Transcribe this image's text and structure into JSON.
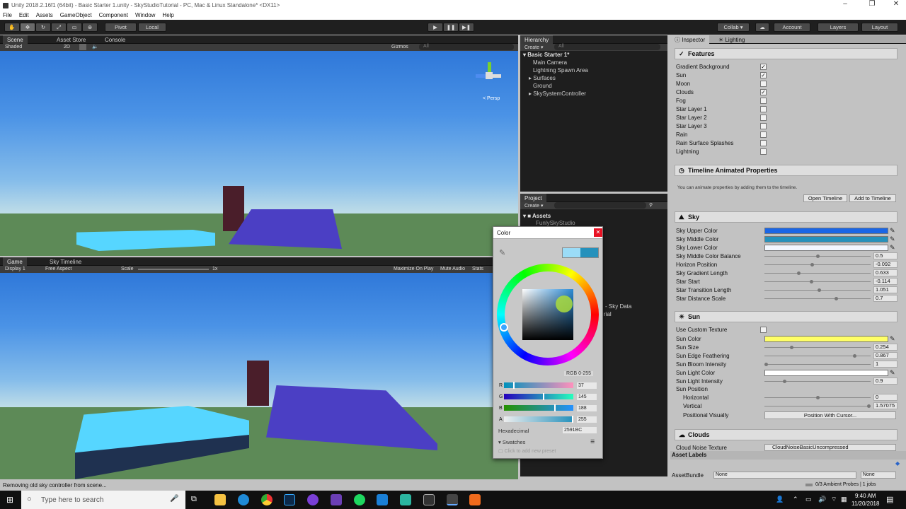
{
  "window": {
    "title": "Unity 2018.2.16f1 (64bit) - Basic Starter 1.unity - SkyStudioTutorial - PC, Mac & Linux Standalone* <DX11>"
  },
  "menu": [
    "File",
    "Edit",
    "Assets",
    "GameObject",
    "Component",
    "Window",
    "Help"
  ],
  "toolbar": {
    "pivot": "Pivot",
    "local": "Local",
    "collab": "Collab ▾",
    "account": "Account",
    "layers": "Layers",
    "layout": "Layout"
  },
  "scene": {
    "tabs": [
      "Scene",
      "Asset Store",
      "Console"
    ],
    "shaded": "Shaded",
    "mode2d": "2D",
    "gizmos": "Gizmos",
    "search": "All",
    "persp": "< Persp"
  },
  "game": {
    "tabs": [
      "Game",
      "Sky Timeline"
    ],
    "display": "Display 1",
    "aspect": "Free Aspect",
    "scale_label": "Scale",
    "scale_value": "1x",
    "maximize": "Maximize On Play",
    "mute": "Mute Audio",
    "stats": "Stats"
  },
  "hierarchy": {
    "tab": "Hierarchy",
    "create": "Create ▾",
    "search": "All",
    "scene": "Basic Starter 1*",
    "items": [
      "Main Camera",
      "Lightning Spawn Area",
      "Surfaces",
      "Ground",
      "SkySystemController"
    ]
  },
  "project": {
    "tab": "Project",
    "create": "Create ▾",
    "root": "Assets",
    "sub": "FunlySkyStudio",
    "partial1": "- Sky Data",
    "partial2": "rial"
  },
  "color_picker": {
    "title": "Color",
    "mode": "RGB 0-255",
    "channels": [
      {
        "label": "R",
        "value": "37"
      },
      {
        "label": "G",
        "value": "145"
      },
      {
        "label": "B",
        "value": "188"
      },
      {
        "label": "A",
        "value": "255"
      }
    ],
    "hex_label": "Hexadecimal",
    "hex_value": "2591BC",
    "swatches": "Swatches",
    "preset": "Click to add new preset"
  },
  "inspector": {
    "tabs": [
      "Inspector",
      "Lighting"
    ],
    "features": {
      "title": "Features",
      "items": [
        {
          "label": "Gradient Background",
          "checked": true
        },
        {
          "label": "Sun",
          "checked": true
        },
        {
          "label": "Moon",
          "checked": false
        },
        {
          "label": "Clouds",
          "checked": true
        },
        {
          "label": "Fog",
          "checked": false
        },
        {
          "label": "Star Layer 1",
          "checked": false
        },
        {
          "label": "Star Layer 2",
          "checked": false
        },
        {
          "label": "Star Layer 3",
          "checked": false
        },
        {
          "label": "Rain",
          "checked": false
        },
        {
          "label": "Rain Surface Splashes",
          "checked": false
        },
        {
          "label": "Lightning",
          "checked": false
        }
      ]
    },
    "timeline": {
      "title": "Timeline Animated Properties",
      "note": "You can animate properties by adding them to the timeline.",
      "open": "Open Timeline",
      "add": "Add to Timeline"
    },
    "sky": {
      "title": "Sky",
      "colors": [
        {
          "label": "Sky Upper Color",
          "color": "#1a66e6"
        },
        {
          "label": "Sky Middle Color",
          "color": "#2591bc"
        },
        {
          "label": "Sky Lower Color",
          "color": "#f2f7ff"
        }
      ],
      "sliders": [
        {
          "label": "Sky Middle Color Balance",
          "value": "0.5",
          "pos": 0.5
        },
        {
          "label": "Horizon Position",
          "value": "-0.092",
          "pos": 0.45
        },
        {
          "label": "Sky Gradient Length",
          "value": "0.633",
          "pos": 0.32
        },
        {
          "label": "Star Start",
          "value": "-0.114",
          "pos": 0.44
        },
        {
          "label": "Star Transition Length",
          "value": "1.051",
          "pos": 0.52
        },
        {
          "label": "Star Distance Scale",
          "value": "0.7",
          "pos": 0.68
        }
      ]
    },
    "sun": {
      "title": "Sun",
      "custom_texture": "Use Custom Texture",
      "sun_color_label": "Sun Color",
      "sun_color": "#ffff66",
      "sliders": [
        {
          "label": "Sun Size",
          "value": "0.254",
          "pos": 0.25
        },
        {
          "label": "Sun Edge Feathering",
          "value": "0.867",
          "pos": 0.86
        },
        {
          "label": "Sun Bloom Intensity",
          "value": "1",
          "pos": 0.0
        }
      ],
      "light_color_label": "Sun Light Color",
      "light_color": "#ffffff",
      "intensity": {
        "label": "Sun Light Intensity",
        "value": "0.9",
        "pos": 0.18
      },
      "position": "Sun Position",
      "horizontal": {
        "label": "Horizontal",
        "value": "0",
        "pos": 0.5
      },
      "vertical": {
        "label": "Vertical",
        "value": "1.57075",
        "pos": 1.0
      },
      "visually": "Positional Visually",
      "cursor": "Position With Cursor..."
    },
    "clouds": {
      "title": "Clouds",
      "noise_label": "Cloud Noise Texture",
      "noise_value": "CloudNoiseBasicUncompressed"
    },
    "asset_labels": "Asset Labels",
    "asset_bundle": "AssetBundle",
    "none1": "None",
    "none2": "None"
  },
  "status": {
    "message": "Removing old sky controller from scene...",
    "probes": "0/3 Ambient Probes | 1 jobs"
  },
  "taskbar": {
    "search": "Type here to search",
    "time": "9:40 AM",
    "date": "11/20/2018"
  }
}
